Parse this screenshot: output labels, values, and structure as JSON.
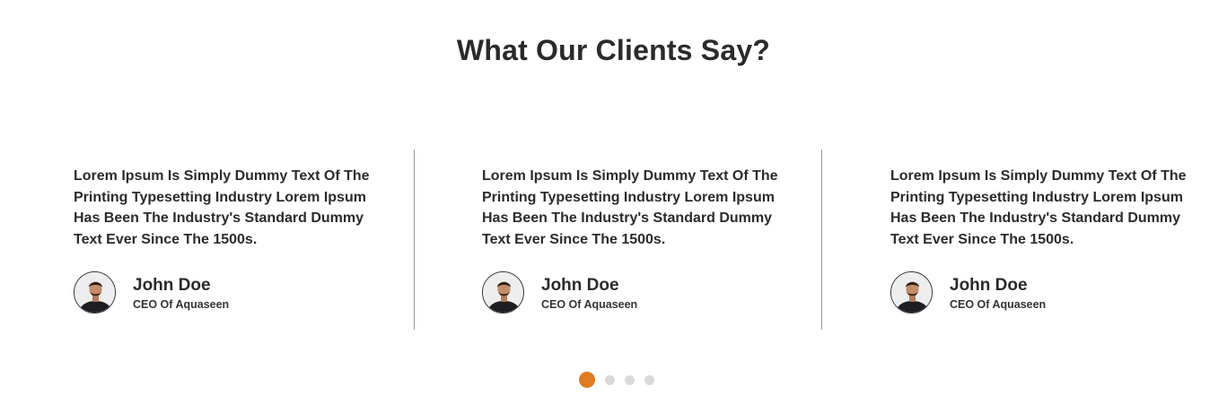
{
  "section": {
    "title": "What Our Clients Say?"
  },
  "testimonials": [
    {
      "quote": "Lorem Ipsum Is Simply Dummy Text Of The\nPrinting  Typesetting Industry Lorem Ipsum\nHas Been The Industry's Standard Dummy\nText Ever Since The 1500s.",
      "name": "John Doe",
      "role": "CEO Of Aquaseen"
    },
    {
      "quote": "Lorem Ipsum Is Simply Dummy Text Of The\nPrinting  Typesetting Industry Lorem Ipsum\nHas Been The Industry's Standard Dummy\nText Ever Since The 1500s.",
      "name": "John Doe",
      "role": "CEO Of Aquaseen"
    },
    {
      "quote": "Lorem Ipsum Is Simply Dummy Text Of The\nPrinting  Typesetting Industry Lorem Ipsum\nHas Been The Industry's Standard Dummy\nText Ever Since The 1500s.",
      "name": "John Doe",
      "role": "CEO Of Aquaseen"
    }
  ],
  "pagination": {
    "total": 4,
    "active_index": 0
  },
  "colors": {
    "accent": "#e07b22",
    "inactive_dot": "#d9d9d9",
    "divider": "#9a9a9a"
  }
}
